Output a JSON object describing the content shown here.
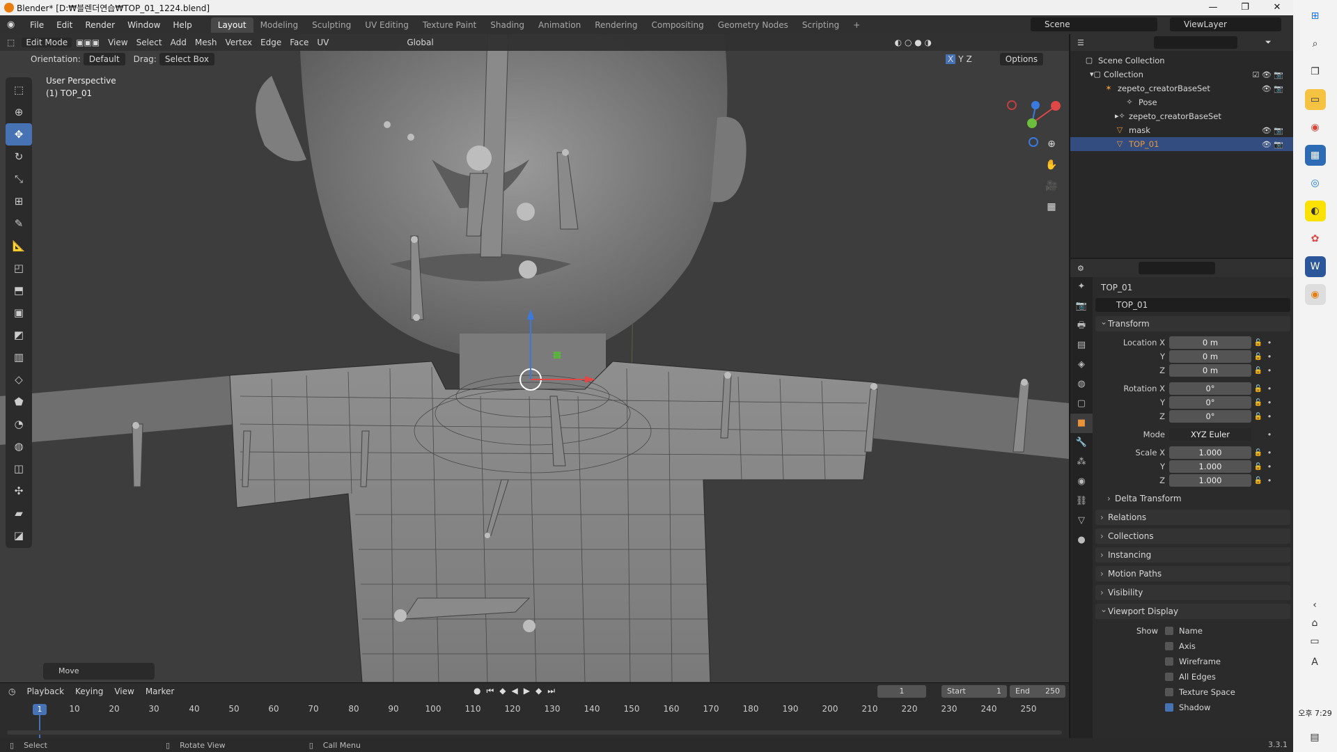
{
  "window": {
    "title": "Blender* [D:₩블렌더연습₩TOP_01_1224.blend]",
    "controls": [
      "—",
      "❐",
      "✕"
    ]
  },
  "menu": [
    "File",
    "Edit",
    "Render",
    "Window",
    "Help"
  ],
  "workspaces": [
    "Layout",
    "Modeling",
    "Sculpting",
    "UV Editing",
    "Texture Paint",
    "Shading",
    "Animation",
    "Rendering",
    "Compositing",
    "Geometry Nodes",
    "Scripting",
    "+"
  ],
  "scene": "Scene",
  "view_layer": "ViewLayer",
  "viewport": {
    "mode": "Edit Mode",
    "menus": [
      "View",
      "Select",
      "Add",
      "Mesh",
      "Vertex",
      "Edge",
      "Face",
      "UV"
    ],
    "transform_space": "Global",
    "orientation_label": "Orientation:",
    "orientation_value": "Default",
    "drag_label": "Drag:",
    "drag_value": "Select Box",
    "axes": [
      "X",
      "Y",
      "Z"
    ],
    "options": "Options",
    "info_line1": "User Perspective",
    "info_line2": "(1) TOP_01",
    "last_op": "Move"
  },
  "outliner": {
    "rows": [
      {
        "label": "Scene Collection"
      },
      {
        "label": "Collection"
      },
      {
        "label": "zepeto_creatorBaseSet"
      },
      {
        "label": "Pose"
      },
      {
        "label": "zepeto_creatorBaseSet"
      },
      {
        "label": "mask"
      },
      {
        "label": "TOP_01"
      }
    ]
  },
  "properties": {
    "object_name": "TOP_01",
    "object_field": "TOP_01",
    "transform_title": "Transform",
    "location_x_label": "Location X",
    "location_x": "0 m",
    "location_y_label": "Y",
    "location_y": "0 m",
    "location_z_label": "Z",
    "location_z": "0 m",
    "rotation_x_label": "Rotation X",
    "rotation_x": "0°",
    "rotation_y_label": "Y",
    "rotation_y": "0°",
    "rotation_z_label": "Z",
    "rotation_z": "0°",
    "mode_label": "Mode",
    "mode_value": "XYZ Euler",
    "scale_x_label": "Scale X",
    "scale_x": "1.000",
    "scale_y_label": "Y",
    "scale_y": "1.000",
    "scale_z_label": "Z",
    "scale_z": "1.000",
    "delta_transform": "Delta Transform",
    "panels": [
      "Relations",
      "Collections",
      "Instancing",
      "Motion Paths",
      "Visibility"
    ],
    "viewport_display": "Viewport Display",
    "show_label": "Show",
    "show_items": [
      {
        "label": "Name",
        "checked": false
      },
      {
        "label": "Axis",
        "checked": false
      },
      {
        "label": "Wireframe",
        "checked": false
      },
      {
        "label": "All Edges",
        "checked": false
      },
      {
        "label": "Texture Space",
        "checked": false
      },
      {
        "label": "Shadow",
        "checked": true
      }
    ]
  },
  "timeline": {
    "menus": [
      "Playback",
      "Keying",
      "View",
      "Marker"
    ],
    "current_frame": "1",
    "start_label": "Start",
    "start": "1",
    "end_label": "End",
    "end": "250",
    "ticks": [
      "10",
      "20",
      "30",
      "40",
      "50",
      "60",
      "70",
      "80",
      "90",
      "100",
      "110",
      "120",
      "130",
      "140",
      "150",
      "160",
      "170",
      "180",
      "190",
      "200",
      "210",
      "220",
      "230",
      "240",
      "250"
    ],
    "playhead": "1"
  },
  "statusbar": {
    "select": "Select",
    "rotate": "Rotate View",
    "call_menu": "Call Menu",
    "version": "3.3.1"
  },
  "taskbar": {
    "clock": "오후 7:29",
    "ime": "A"
  }
}
